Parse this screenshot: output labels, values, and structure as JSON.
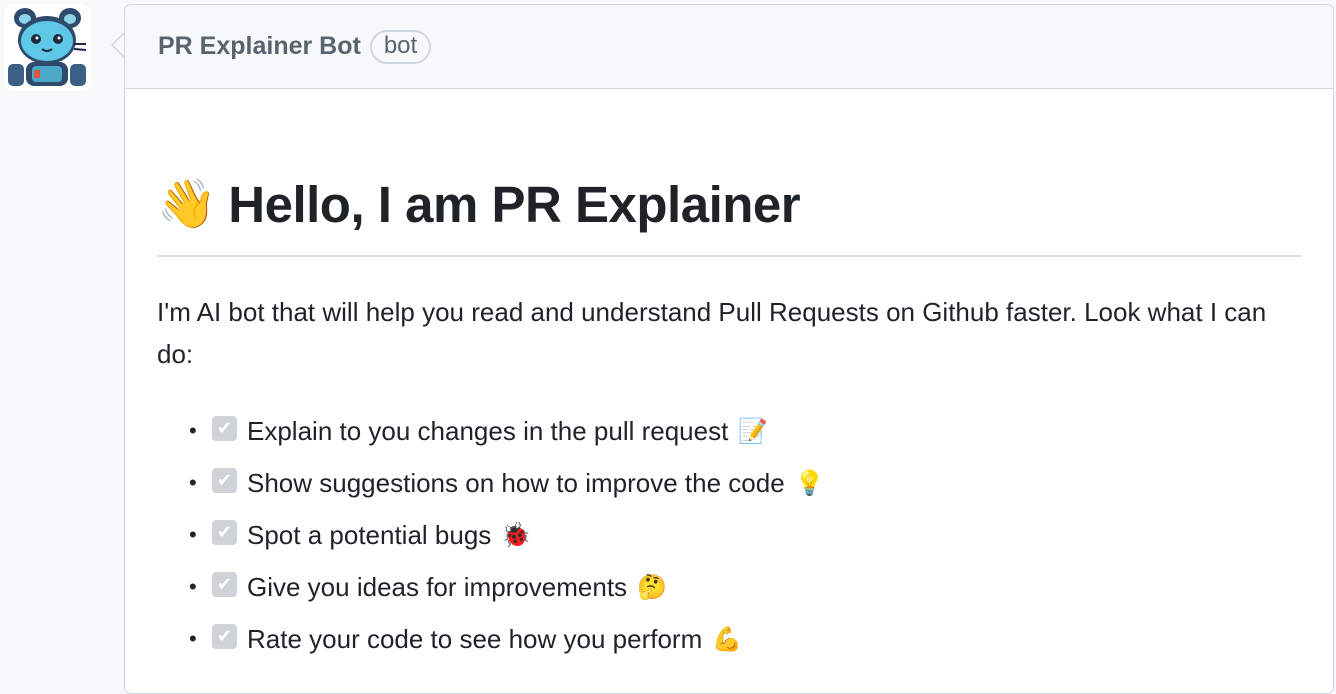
{
  "comment": {
    "author": "PR Explainer Bot",
    "badge": "bot"
  },
  "content": {
    "wave_emoji": "👋",
    "title": "Hello, I am PR Explainer",
    "intro": "I'm AI bot that will help you read and understand Pull Requests on Github faster. Look what I can do:",
    "check_glyph": "✔",
    "features": [
      {
        "text": "Explain to you changes in the pull request",
        "emoji": "📝"
      },
      {
        "text": "Show suggestions on how to improve the code",
        "emoji": "💡"
      },
      {
        "text": "Spot a potential bugs",
        "emoji": "🐞"
      },
      {
        "text": "Give you ideas for improvements",
        "emoji": "🤔"
      },
      {
        "text": "Rate your code to see how you perform",
        "emoji": "💪"
      }
    ]
  },
  "colors": {
    "header_bg": "#f6f8fa",
    "border": "#d0d7de",
    "checkbox": "#cfd3d8",
    "avatar_cat": "#5ec8e6"
  },
  "icons": {
    "avatar": "robot-cat-avatar",
    "checkbox": "checked-checkbox-icon"
  }
}
